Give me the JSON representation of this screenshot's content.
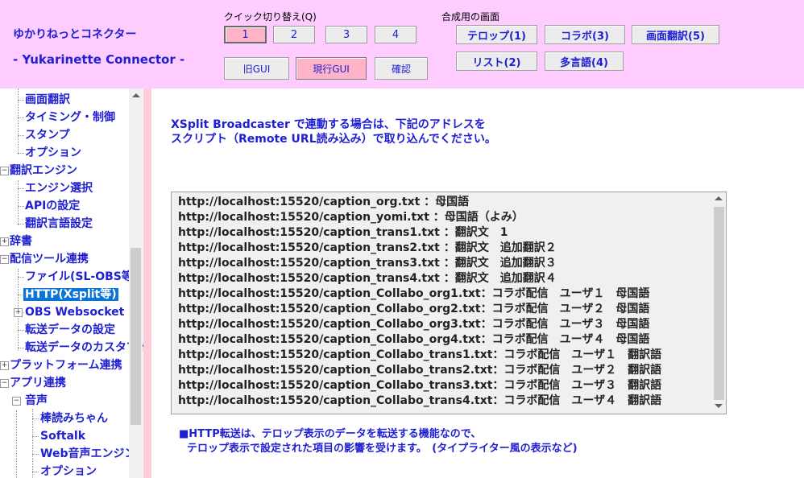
{
  "app": {
    "title_jp": "ゆかりねっとコネクター",
    "title_en": "- Yukarinette Connector -"
  },
  "header": {
    "quick_switch_label": "クイック切り替え(Q)",
    "quick_buttons": [
      "1",
      "2",
      "3",
      "4"
    ],
    "quick_active_index": 0,
    "gui_buttons": [
      "旧GUI",
      "現行GUI",
      "確認"
    ],
    "gui_active_index": 1,
    "composite_label": "合成用の画面",
    "composite_buttons": [
      "テロップ(1)",
      "コラボ(3)",
      "画面翻訳(5)",
      "リスト(2)",
      "多言語(4)"
    ]
  },
  "sidebar": {
    "items": [
      {
        "label": "画面翻訳",
        "level": 1
      },
      {
        "label": "タイミング・制御",
        "level": 1
      },
      {
        "label": "スタンプ",
        "level": 1
      },
      {
        "label": "オプション",
        "level": 1
      },
      {
        "label": "翻訳エンジン",
        "level": 0,
        "expander": "−"
      },
      {
        "label": "エンジン選択",
        "level": 1
      },
      {
        "label": "APIの設定",
        "level": 1
      },
      {
        "label": "翻訳言語設定",
        "level": 1
      },
      {
        "label": "辞書",
        "level": 0,
        "expander": "+"
      },
      {
        "label": "配信ツール連携",
        "level": 0,
        "expander": "−"
      },
      {
        "label": "ファイル(SL-OBS等)",
        "level": 1
      },
      {
        "label": "HTTP(Xsplit等)",
        "level": 1,
        "selected": true
      },
      {
        "label": "OBS Websocket",
        "level": 1,
        "expander": "+"
      },
      {
        "label": "転送データの設定",
        "level": 1
      },
      {
        "label": "転送データのカスタマイズ",
        "level": 1
      },
      {
        "label": "プラットフォーム連携",
        "level": 0,
        "expander": "+"
      },
      {
        "label": "アプリ連携",
        "level": 0,
        "expander": "−"
      },
      {
        "label": "音声",
        "level": 1,
        "expander": "−"
      },
      {
        "label": "棒読みちゃん",
        "level": 2
      },
      {
        "label": "Softalk",
        "level": 2
      },
      {
        "label": "Web音声エンジン",
        "level": 2
      },
      {
        "label": "オプション",
        "level": 2
      }
    ]
  },
  "main": {
    "intro_line1": "XSplit Broadcaster で連動する場合は、下記のアドレスを",
    "intro_line2": "スクリプト（Remote URL読み込み）で取り込んでください。",
    "urls": [
      "http://localhost:15520/caption_org.txt ：母国語",
      "http://localhost:15520/caption_yomi.txt ：母国語（よみ）",
      "http://localhost:15520/caption_trans1.txt ：翻訳文　1",
      "http://localhost:15520/caption_trans2.txt ：翻訳文　追加翻訳２",
      "http://localhost:15520/caption_trans3.txt ：翻訳文　追加翻訳３",
      "http://localhost:15520/caption_trans4.txt ：翻訳文　追加翻訳４",
      "http://localhost:15520/caption_Collabo_org1.txt：コラボ配信　ユーザ１　母国語",
      "http://localhost:15520/caption_Collabo_org2.txt：コラボ配信　ユーザ２　母国語",
      "http://localhost:15520/caption_Collabo_org3.txt：コラボ配信　ユーザ３　母国語",
      "http://localhost:15520/caption_Collabo_org4.txt：コラボ配信　ユーザ４　母国語",
      "http://localhost:15520/caption_Collabo_trans1.txt：コラボ配信　ユーザ１　翻訳語",
      "http://localhost:15520/caption_Collabo_trans2.txt：コラボ配信　ユーザ２　翻訳語",
      "http://localhost:15520/caption_Collabo_trans3.txt：コラボ配信　ユーザ３　翻訳語",
      "http://localhost:15520/caption_Collabo_trans4.txt：コラボ配信　ユーザ４　翻訳語"
    ],
    "note_line1": "■HTTP転送は、テロップ表示のデータを転送する機能なので、",
    "note_line2": "テロップ表示で設定された項目の影響を受けます。　(タイプライター風の表示など)"
  },
  "colors": {
    "header_bg": "#ffccff",
    "accent_text": "#1e1ed2",
    "active_button": "#ffb3c6",
    "selected_item": "#0a74d8",
    "pink_bar": "#ffccd8"
  }
}
